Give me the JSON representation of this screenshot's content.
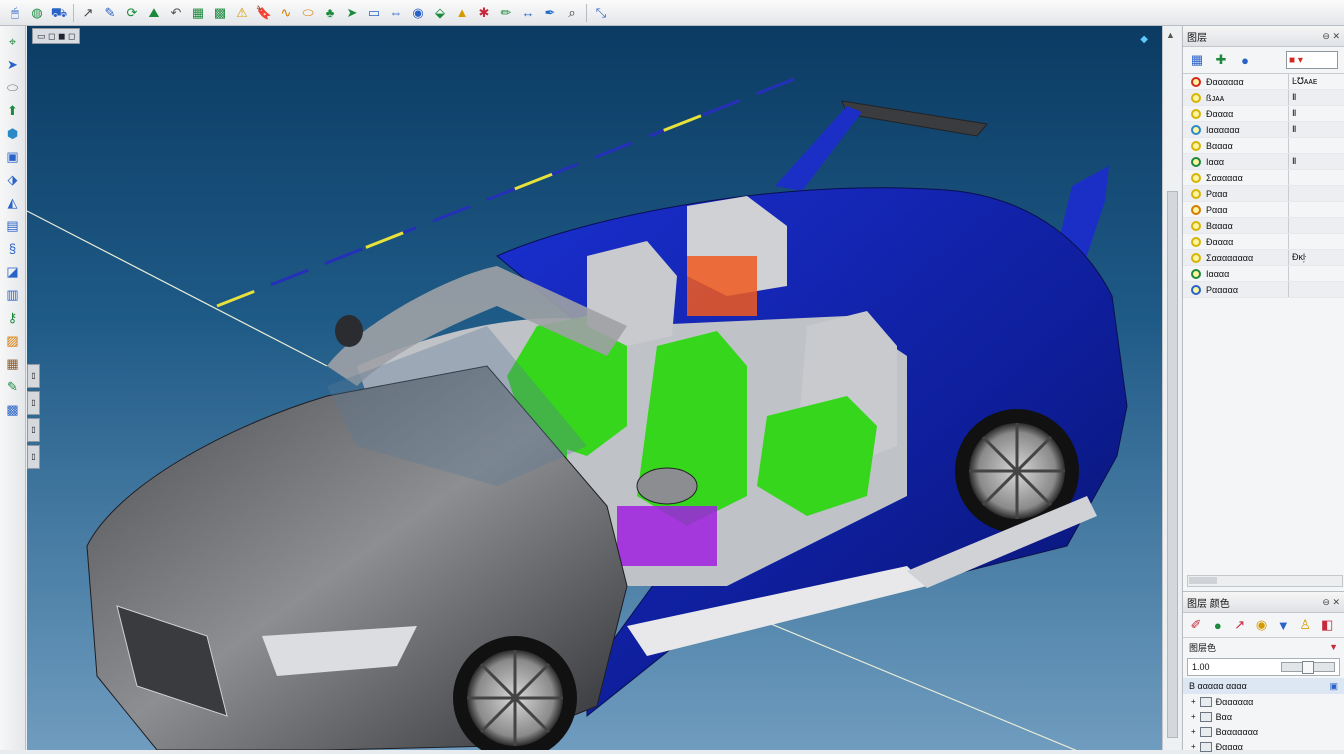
{
  "toolbar": {
    "buttons": [
      {
        "name": "select-icon",
        "glyph": "🖱",
        "color": "#2a63c8"
      },
      {
        "name": "globe-icon",
        "glyph": "◍",
        "color": "#1c8a3d"
      },
      {
        "name": "camera-icon",
        "glyph": "⛟",
        "color": "#2a63c8"
      },
      {
        "name": "curve-icon",
        "glyph": "↗",
        "color": "#444"
      },
      {
        "name": "sketch-icon",
        "glyph": "✎",
        "color": "#2a63c8"
      },
      {
        "name": "rotate-icon",
        "glyph": "⟳",
        "color": "#1c8a3d"
      },
      {
        "name": "surface-icon",
        "glyph": "⛰",
        "color": "#1c8a3d"
      },
      {
        "name": "undo-icon",
        "glyph": "↶",
        "color": "#555"
      },
      {
        "name": "table-icon",
        "glyph": "▦",
        "color": "#1c8a3d"
      },
      {
        "name": "grid-icon",
        "glyph": "▩",
        "color": "#1c8a3d"
      },
      {
        "name": "warning-icon",
        "glyph": "⚠",
        "color": "#d69a00"
      },
      {
        "name": "bookmark-icon",
        "glyph": "🔖",
        "color": "#2a63c8"
      },
      {
        "name": "wave-icon",
        "glyph": "∿",
        "color": "#d47a00"
      },
      {
        "name": "plane-icon",
        "glyph": "⬭",
        "color": "#d47a00"
      },
      {
        "name": "tree-icon",
        "glyph": "♣",
        "color": "#1c8a3d"
      },
      {
        "name": "arrow-icon",
        "glyph": "➤",
        "color": "#1c8a3d"
      },
      {
        "name": "panel-icon",
        "glyph": "▭",
        "color": "#2a63c8"
      },
      {
        "name": "move-icon",
        "glyph": "⇔",
        "color": "#2a63c8"
      },
      {
        "name": "eye-icon",
        "glyph": "◉",
        "color": "#2a63c8"
      },
      {
        "name": "view-icon",
        "glyph": "⬙",
        "color": "#1c8a3d"
      },
      {
        "name": "triangle-icon",
        "glyph": "▲",
        "color": "#d69a00"
      },
      {
        "name": "paint-icon",
        "glyph": "✱",
        "color": "#c8283c"
      },
      {
        "name": "pencil-icon",
        "glyph": "✏",
        "color": "#1c8a3d"
      },
      {
        "name": "dimension-icon",
        "glyph": "↔",
        "color": "#2a63c8"
      },
      {
        "name": "pen-icon",
        "glyph": "✒",
        "color": "#1c6ac8"
      },
      {
        "name": "search-icon",
        "glyph": "⌕",
        "color": "#333"
      },
      {
        "name": "measure-icon",
        "glyph": "⤡",
        "color": "#2a63c8"
      }
    ]
  },
  "left_tools": [
    {
      "name": "point-icon",
      "glyph": "⌖",
      "color": "#1c8a3d"
    },
    {
      "name": "select-tool-icon",
      "glyph": "➤",
      "color": "#2a63c8"
    },
    {
      "name": "shape-icon",
      "glyph": "⬭",
      "color": "#777"
    },
    {
      "name": "extrude-icon",
      "glyph": "⬆",
      "color": "#1c8a3d"
    },
    {
      "name": "solid-icon",
      "glyph": "⬢",
      "color": "#2a8ac8"
    },
    {
      "name": "box-icon",
      "glyph": "▣",
      "color": "#2a63c8"
    },
    {
      "name": "tag-icon",
      "glyph": "⬗",
      "color": "#2a63c8"
    },
    {
      "name": "surface-tool-icon",
      "glyph": "◭",
      "color": "#2a63c8"
    },
    {
      "name": "frame-icon",
      "glyph": "▤",
      "color": "#2a63c8"
    },
    {
      "name": "spring-icon",
      "glyph": "§",
      "color": "#2a63c8"
    },
    {
      "name": "layer-icon",
      "glyph": "◪",
      "color": "#2a63c8"
    },
    {
      "name": "columns-icon",
      "glyph": "▥",
      "color": "#2a63c8"
    },
    {
      "name": "key-icon",
      "glyph": "⚷",
      "color": "#1c8a3d"
    },
    {
      "name": "stack-icon",
      "glyph": "▨",
      "color": "#d47a00"
    },
    {
      "name": "table-tool-icon",
      "glyph": "▦",
      "color": "#8a5a2a"
    },
    {
      "name": "pencil-tool-icon",
      "glyph": "✎",
      "color": "#1c8a3d"
    },
    {
      "name": "chart-icon",
      "glyph": "▩",
      "color": "#2a63c8"
    }
  ],
  "viewport": {
    "label": "▭ ◻ ◼ ◻",
    "corner": "◆",
    "side_tabs": [
      "▯",
      "▯",
      "▯",
      "▯"
    ]
  },
  "layers_panel": {
    "title": "图层",
    "header_controls": "⊖ ✕",
    "swatch_label": "■ ▾",
    "rows": [
      {
        "name": "Ðαααααα",
        "value": "Ŀ℧ᴀᴀᴇ",
        "icon_color": "#d2281e"
      },
      {
        "name": "ßᴊᴀᴀ",
        "value": "Ⅱ",
        "icon_color": "#d6b400"
      },
      {
        "name": "Ðαααα",
        "value": "Ⅱ",
        "icon_color": "#d6b400"
      },
      {
        "name": "Ιαααααα",
        "value": "Ⅱ",
        "icon_color": "#2a8ac8"
      },
      {
        "name": "Βαααα",
        "value": "",
        "icon_color": "#d6b400"
      },
      {
        "name": "Ιααα",
        "value": "Ⅱ",
        "icon_color": "#1c8a3d"
      },
      {
        "name": "Σαααααα",
        "value": "",
        "icon_color": "#d6b400"
      },
      {
        "name": "Ρααα",
        "value": "",
        "icon_color": "#d6b400"
      },
      {
        "name": "Ρααα",
        "value": "",
        "icon_color": "#d47a00"
      },
      {
        "name": "Βαααα",
        "value": "",
        "icon_color": "#d6b400"
      },
      {
        "name": "Ðαααα",
        "value": "",
        "icon_color": "#d6b400"
      },
      {
        "name": "Σαααααααα",
        "value": "Ðĸŀ᷊",
        "icon_color": "#d6b400"
      },
      {
        "name": "Ιαααα",
        "value": "",
        "icon_color": "#1c8a3d"
      },
      {
        "name": "Ρααααα",
        "value": "",
        "icon_color": "#2a63c8"
      }
    ]
  },
  "properties_panel": {
    "title": "图层 颜色",
    "header_controls": "⊖ ✕",
    "tool_glyphs": [
      {
        "name": "brush-icon",
        "glyph": "✐",
        "color": "#c8283c"
      },
      {
        "name": "dot-icon",
        "glyph": "●",
        "color": "#1c8a3d"
      },
      {
        "name": "curve-tool-icon",
        "glyph": "↗",
        "color": "#c8283c"
      },
      {
        "name": "circle-icon",
        "glyph": "◉",
        "color": "#d69a00"
      },
      {
        "name": "drop-icon",
        "glyph": "▼",
        "color": "#2a63c8"
      },
      {
        "name": "lamp-icon",
        "glyph": "♙",
        "color": "#d69a00"
      },
      {
        "name": "clip-icon",
        "glyph": "◧",
        "color": "#c8283c"
      }
    ],
    "section_label": "图层色",
    "section_icon": "▼",
    "input_label": "1.00",
    "tree_header": "Β ααααα αααα",
    "tree_badge": "▣",
    "tree_items": [
      "Ðαααααα",
      "Βαα",
      "Βααααααα",
      "Ðαααα"
    ]
  }
}
